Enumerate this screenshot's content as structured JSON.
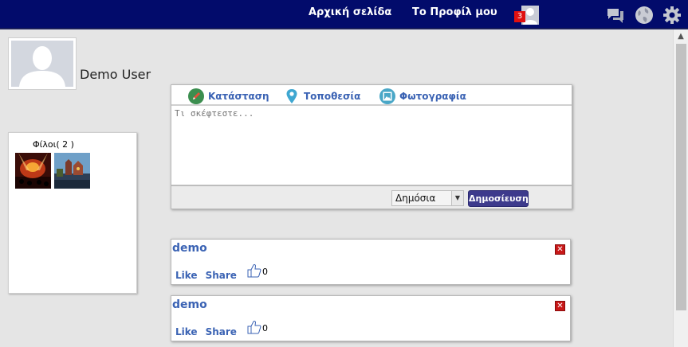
{
  "nav": {
    "home_label": "Αρχική σελίδα",
    "profile_label": "Το Προφίλ μου",
    "notification_count": "3"
  },
  "profile": {
    "name": "Demo User"
  },
  "friends": {
    "title": "Φίλοι( 2 )"
  },
  "composer": {
    "tabs": [
      {
        "label": "Κατάσταση",
        "icon": "pencil-icon"
      },
      {
        "label": "Τοποθεσία",
        "icon": "location-pin-icon"
      },
      {
        "label": "Φωτογραφία",
        "icon": "photo-icon"
      }
    ],
    "placeholder": "Τι σκέφτεστε...",
    "privacy_value": "Δημόσια",
    "post_button": "Δημοσίευση"
  },
  "posts": [
    {
      "author": "demo",
      "like_label": "Like",
      "share_label": "Share",
      "likes": "0"
    },
    {
      "author": "demo",
      "like_label": "Like",
      "share_label": "Share",
      "likes": "0"
    }
  ],
  "colors": {
    "nav_bg": "#020b6b",
    "link": "#3b63b4",
    "post_button": "#3d3a8c",
    "delete": "#c81818"
  }
}
